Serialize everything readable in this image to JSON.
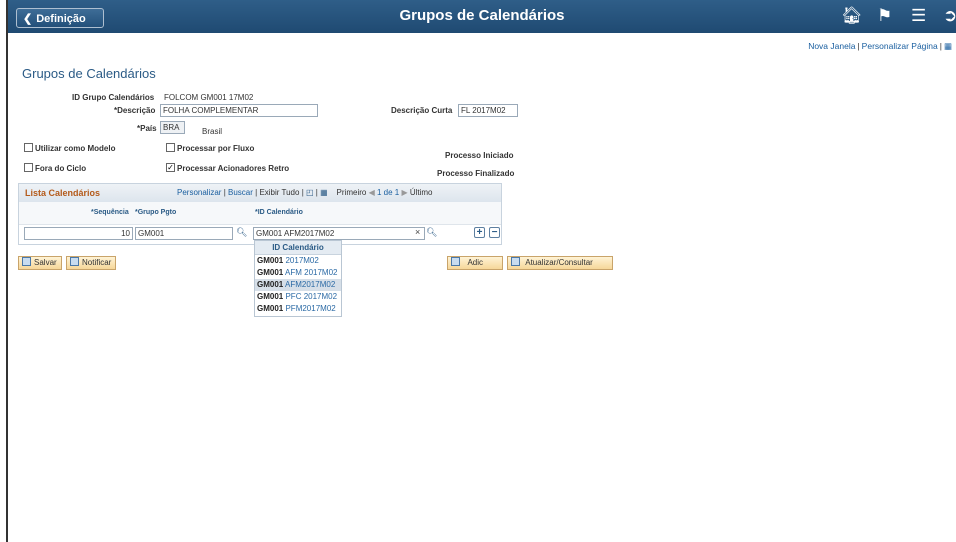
{
  "header": {
    "back_label": "Definição",
    "title": "Grupos de Calendários",
    "icons": [
      "home-icon",
      "flag-icon",
      "menu-icon",
      "navbar-icon"
    ]
  },
  "top_links": {
    "new_window": "Nova Janela",
    "personalize_page": "Personalizar Página"
  },
  "page": {
    "title": "Grupos de Calendários",
    "group_id_label": "ID Grupo Calendários",
    "group_id_value": "FOLCOM GM001 17M02",
    "description_label": "*Descrição",
    "description_value": "FOLHA COMPLEMENTAR",
    "short_desc_label": "Descrição Curta",
    "short_desc_value": "FL 2017M02",
    "country_label": "*País",
    "country_value": "BRA",
    "country_name": "Brasil",
    "use_as_model_label": "Utilizar como Modelo",
    "process_by_flow_label": "Processar por Fluxo",
    "process_started_label": "Processo Iniciado",
    "off_cycle_label": "Fora do Ciclo",
    "retro_triggers_label": "Processar Acionadores Retro",
    "process_finished_label": "Processo Finalizado"
  },
  "grid": {
    "title": "Lista Calendários",
    "personalize": "Personalizar",
    "find": "Buscar",
    "view_all": "Exibir Tudo",
    "first": "Primeiro",
    "count": "1 de 1",
    "last": "Último",
    "columns": [
      "*Sequência",
      "*Grupo Pgto",
      "*ID Calendário"
    ],
    "row": {
      "sequence": "10",
      "pay_group": "GM001",
      "calendar_id": "GM001 AFM2017M02"
    }
  },
  "dropdown": {
    "header": "ID Calendário",
    "items": [
      {
        "bold": "GM001",
        "rest": "2017M02"
      },
      {
        "bold": "GM001",
        "rest": "AFM 2017M02"
      },
      {
        "bold": "GM001",
        "rest": "AFM2017M02"
      },
      {
        "bold": "GM001",
        "rest": "PFC 2017M02"
      },
      {
        "bold": "GM001",
        "rest": "PFM2017M02"
      }
    ]
  },
  "buttons": {
    "save": "Salvar",
    "notify": "Notificar",
    "add": "Adic",
    "update": "Atualizar/Consultar"
  }
}
